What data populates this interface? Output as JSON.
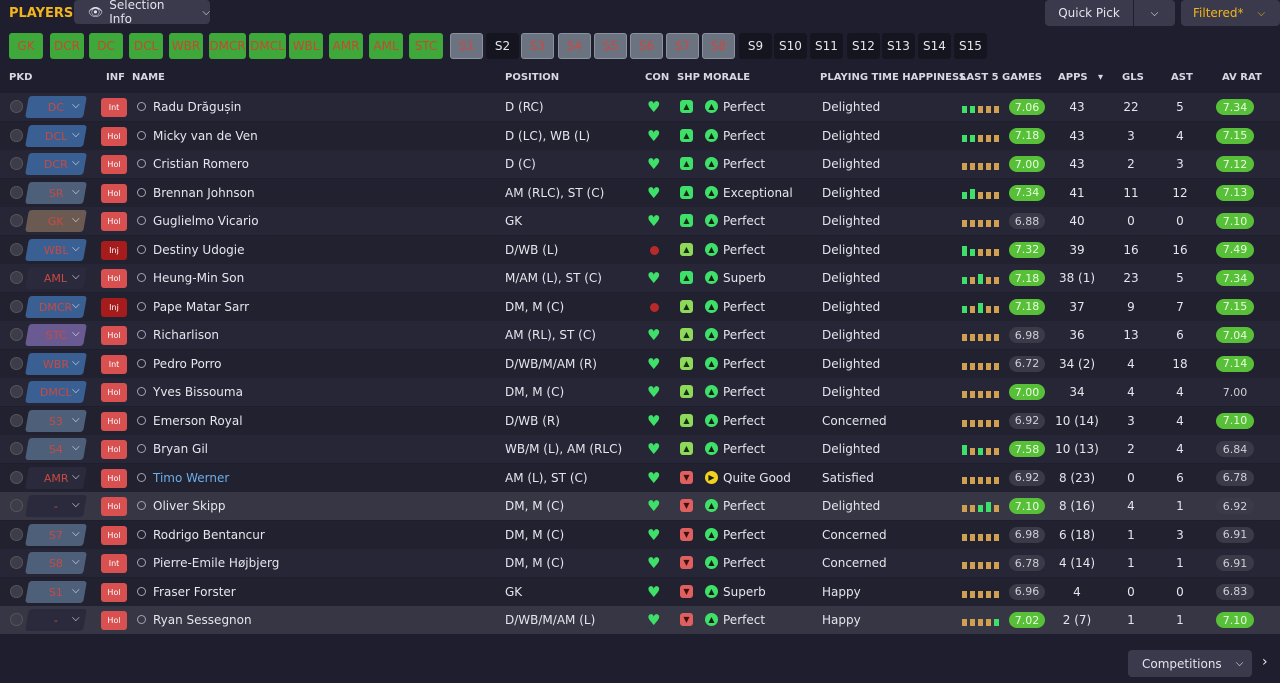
{
  "title": "PLAYERS",
  "selection_info": "Selection Info",
  "quick_pick": "Quick Pick",
  "filtered": "Filtered*",
  "competitions": "Competitions",
  "slots": [
    {
      "label": "GK",
      "style": "g"
    },
    {
      "label": "DCR",
      "style": "g"
    },
    {
      "label": "DC",
      "style": "g"
    },
    {
      "label": "DCL",
      "style": "g"
    },
    {
      "label": "WBR",
      "style": "g"
    },
    {
      "label": "DMCR",
      "style": "g"
    },
    {
      "label": "DMCL",
      "style": "g"
    },
    {
      "label": "WBL",
      "style": "g"
    },
    {
      "label": "AMR",
      "style": "g"
    },
    {
      "label": "AML",
      "style": "g"
    },
    {
      "label": "STC",
      "style": "g"
    },
    {
      "label": "S1",
      "style": "b"
    },
    {
      "label": "S2",
      "style": "k"
    },
    {
      "label": "S3",
      "style": "b"
    },
    {
      "label": "S4",
      "style": "b"
    },
    {
      "label": "S5",
      "style": "b"
    },
    {
      "label": "S6",
      "style": "b"
    },
    {
      "label": "S7",
      "style": "b"
    },
    {
      "label": "S8",
      "style": "b"
    },
    {
      "label": "S9",
      "style": "k"
    },
    {
      "label": "S10",
      "style": "k"
    },
    {
      "label": "S11",
      "style": "k"
    },
    {
      "label": "S12",
      "style": "k"
    },
    {
      "label": "S13",
      "style": "k"
    },
    {
      "label": "S14",
      "style": "k"
    },
    {
      "label": "S15",
      "style": "k"
    }
  ],
  "columns": {
    "pkd": "PKD",
    "inf": "INF",
    "name": "NAME",
    "position": "POSITION",
    "con": "CON",
    "shp": "SHP",
    "morale": "MORALE",
    "pth": "PLAYING TIME HAPPINESS",
    "last5": "LAST 5 GAMES",
    "apps": "APPS",
    "gls": "GLS",
    "ast": "AST",
    "avrat": "AV RAT"
  },
  "colors": {
    "accent": "#f2b51e",
    "green": "#3ee06a",
    "red": "#d85050"
  },
  "players": [
    {
      "pos": "DC",
      "pc": "#3a5f92",
      "inf": "Int",
      "infc": "int",
      "name": "Radu Drăgușin",
      "position": "D (RC)",
      "con": "heart",
      "shp": "up",
      "mor": "g",
      "morale": "Perfect",
      "pth": "Delighted",
      "bars": [
        "g",
        "g",
        "o",
        "o",
        "o"
      ],
      "rating": "7.06",
      "rs": "grn",
      "apps": "43",
      "gls": "22",
      "ast": "5",
      "avrat": "7.34",
      "as": "grn"
    },
    {
      "pos": "DCL",
      "pc": "#3a5f92",
      "inf": "Hol",
      "infc": "hol",
      "name": "Micky van de Ven",
      "position": "D (LC), WB (L)",
      "con": "heart",
      "shp": "up",
      "mor": "g",
      "morale": "Perfect",
      "pth": "Delighted",
      "bars": [
        "g",
        "g",
        "o",
        "o",
        "o"
      ],
      "rating": "7.18",
      "rs": "grn",
      "apps": "43",
      "gls": "3",
      "ast": "4",
      "avrat": "7.15",
      "as": "grn"
    },
    {
      "pos": "DCR",
      "pc": "#3a5f92",
      "inf": "Hol",
      "infc": "hol",
      "name": "Cristian Romero",
      "position": "D (C)",
      "con": "heart",
      "shp": "up",
      "mor": "g",
      "morale": "Perfect",
      "pth": "Delighted",
      "bars": [
        "o",
        "o",
        "o",
        "o",
        "o"
      ],
      "rating": "7.00",
      "rs": "grn",
      "apps": "43",
      "gls": "2",
      "ast": "3",
      "avrat": "7.12",
      "as": "grn"
    },
    {
      "pos": "SR",
      "pc": "#4e5f7a",
      "inf": "Hol",
      "infc": "hol",
      "name": "Brennan Johnson",
      "position": "AM (RLC), ST (C)",
      "con": "heart",
      "shp": "up",
      "mor": "g",
      "morale": "Exceptional",
      "pth": "Delighted",
      "bars": [
        "g",
        "G",
        "o",
        "o",
        "o"
      ],
      "rating": "7.34",
      "rs": "grn",
      "apps": "41",
      "gls": "11",
      "ast": "12",
      "avrat": "7.13",
      "as": "grn"
    },
    {
      "pos": "GK",
      "pc": "#6b5a52",
      "inf": "Hol",
      "infc": "hol",
      "name": "Guglielmo Vicario",
      "position": "GK",
      "con": "heart",
      "shp": "up",
      "mor": "g",
      "morale": "Perfect",
      "pth": "Delighted",
      "bars": [
        "o",
        "o",
        "o",
        "o",
        "o"
      ],
      "rating": "6.88",
      "rs": "gry",
      "apps": "40",
      "gls": "0",
      "ast": "0",
      "avrat": "7.10",
      "as": "grn"
    },
    {
      "pos": "WBL",
      "pc": "#3a5f92",
      "inf": "Inj",
      "infc": "inj",
      "name": "Destiny Udogie",
      "position": "D/WB (L)",
      "con": "inj",
      "shp": "mid",
      "mor": "g",
      "morale": "Perfect",
      "pth": "Delighted",
      "bars": [
        "G",
        "g",
        "o",
        "o",
        "o"
      ],
      "rating": "7.32",
      "rs": "grn",
      "apps": "39",
      "gls": "16",
      "ast": "16",
      "avrat": "7.49",
      "as": "grn"
    },
    {
      "pos": "AML",
      "pc": "#2b2a3c",
      "inf": "Hol",
      "infc": "hol",
      "name": "Heung-Min Son",
      "position": "M/AM (L), ST (C)",
      "con": "heart",
      "shp": "up",
      "mor": "g",
      "morale": "Superb",
      "pth": "Delighted",
      "bars": [
        "g",
        "o",
        "G",
        "o",
        "o"
      ],
      "rating": "7.18",
      "rs": "grn",
      "apps": "38 (1)",
      "gls": "23",
      "ast": "5",
      "avrat": "7.34",
      "as": "grn"
    },
    {
      "pos": "DMCR",
      "pc": "#3a5f92",
      "inf": "Inj",
      "infc": "inj",
      "name": "Pape Matar Sarr",
      "position": "DM, M (C)",
      "con": "inj",
      "shp": "mid",
      "mor": "g",
      "morale": "Perfect",
      "pth": "Delighted",
      "bars": [
        "g",
        "o",
        "G",
        "o",
        "o"
      ],
      "rating": "7.18",
      "rs": "grn",
      "apps": "37",
      "gls": "9",
      "ast": "7",
      "avrat": "7.15",
      "as": "grn"
    },
    {
      "pos": "STC",
      "pc": "#6a5a92",
      "inf": "Hol",
      "infc": "hol",
      "name": "Richarlison",
      "position": "AM (RL), ST (C)",
      "con": "heart",
      "shp": "mid",
      "mor": "g",
      "morale": "Perfect",
      "pth": "Delighted",
      "bars": [
        "o",
        "o",
        "o",
        "o",
        "o"
      ],
      "rating": "6.98",
      "rs": "gry",
      "apps": "36",
      "gls": "13",
      "ast": "6",
      "avrat": "7.04",
      "as": "grn"
    },
    {
      "pos": "WBR",
      "pc": "#3a5f92",
      "inf": "Int",
      "infc": "int",
      "name": "Pedro Porro",
      "position": "D/WB/M/AM (R)",
      "con": "heart",
      "shp": "mid",
      "mor": "g",
      "morale": "Perfect",
      "pth": "Delighted",
      "bars": [
        "o",
        "o",
        "o",
        "o",
        "o"
      ],
      "rating": "6.72",
      "rs": "gry",
      "apps": "34 (2)",
      "gls": "4",
      "ast": "18",
      "avrat": "7.14",
      "as": "grn"
    },
    {
      "pos": "DMCL",
      "pc": "#3a5f92",
      "inf": "Hol",
      "infc": "hol",
      "name": "Yves Bissouma",
      "position": "DM, M (C)",
      "con": "heart",
      "shp": "mid",
      "mor": "g",
      "morale": "Perfect",
      "pth": "Delighted",
      "bars": [
        "o",
        "o",
        "o",
        "o",
        "o"
      ],
      "rating": "7.00",
      "rs": "grn",
      "apps": "34",
      "gls": "4",
      "ast": "4",
      "avrat": "7.00",
      "as": "none"
    },
    {
      "pos": "S3",
      "pc": "#4e5f7a",
      "inf": "Hol",
      "infc": "hol",
      "name": "Emerson Royal",
      "position": "D/WB (R)",
      "con": "heart",
      "shp": "mid",
      "mor": "g",
      "morale": "Perfect",
      "pth": "Concerned",
      "bars": [
        "o",
        "o",
        "o",
        "o",
        "o"
      ],
      "rating": "6.92",
      "rs": "gry",
      "apps": "10 (14)",
      "gls": "3",
      "ast": "4",
      "avrat": "7.10",
      "as": "grn"
    },
    {
      "pos": "S4",
      "pc": "#4e5f7a",
      "inf": "Hol",
      "infc": "hol",
      "name": "Bryan Gil",
      "position": "WB/M (L), AM (RLC)",
      "con": "heart",
      "shp": "mid",
      "mor": "g",
      "morale": "Perfect",
      "pth": "Delighted",
      "bars": [
        "G",
        "o",
        "g",
        "o",
        "o"
      ],
      "rating": "7.58",
      "rs": "grn",
      "apps": "10 (13)",
      "gls": "2",
      "ast": "4",
      "avrat": "6.84",
      "as": "gry"
    },
    {
      "pos": "AMR",
      "pc": "#2b2a3c",
      "inf": "Hol",
      "infc": "hol",
      "name": "Timo Werner",
      "position": "AM (L), ST (C)",
      "con": "heart",
      "shp": "down",
      "mor": "y",
      "morale": "Quite Good",
      "pth": "Satisfied",
      "bars": [
        "o",
        "o",
        "o",
        "o",
        "o"
      ],
      "rating": "6.92",
      "rs": "gry",
      "apps": "8 (23)",
      "gls": "0",
      "ast": "6",
      "avrat": "6.78",
      "as": "gry",
      "blue": true
    },
    {
      "pos": "-",
      "pc": "#2b2a3c",
      "inf": "Hol",
      "infc": "hol",
      "name": "Oliver Skipp",
      "position": "DM, M (C)",
      "con": "heart",
      "shp": "down",
      "mor": "g",
      "morale": "Perfect",
      "pth": "Delighted",
      "bars": [
        "o",
        "o",
        "g",
        "G",
        "o"
      ],
      "rating": "7.10",
      "rs": "grn",
      "apps": "8 (16)",
      "gls": "4",
      "ast": "1",
      "avrat": "6.92",
      "as": "gry"
    },
    {
      "pos": "S7",
      "pc": "#4e5f7a",
      "inf": "Hol",
      "infc": "hol",
      "name": "Rodrigo Bentancur",
      "position": "DM, M (C)",
      "con": "heart",
      "shp": "down",
      "mor": "g",
      "morale": "Perfect",
      "pth": "Concerned",
      "bars": [
        "o",
        "o",
        "o",
        "o",
        "o"
      ],
      "rating": "6.98",
      "rs": "gry",
      "apps": "6 (18)",
      "gls": "1",
      "ast": "3",
      "avrat": "6.91",
      "as": "gry"
    },
    {
      "pos": "S8",
      "pc": "#4e5f7a",
      "inf": "Int",
      "infc": "int",
      "name": "Pierre-Emile Højbjerg",
      "position": "DM, M (C)",
      "con": "heart",
      "shp": "down",
      "mor": "g",
      "morale": "Perfect",
      "pth": "Concerned",
      "bars": [
        "o",
        "o",
        "o",
        "o",
        "o"
      ],
      "rating": "6.78",
      "rs": "gry",
      "apps": "4 (14)",
      "gls": "1",
      "ast": "1",
      "avrat": "6.91",
      "as": "gry"
    },
    {
      "pos": "S1",
      "pc": "#4e5f7a",
      "inf": "Hol",
      "infc": "hol",
      "name": "Fraser Forster",
      "position": "GK",
      "con": "heart",
      "shp": "down",
      "mor": "g",
      "morale": "Superb",
      "pth": "Happy",
      "bars": [
        "o",
        "o",
        "o",
        "o",
        "o"
      ],
      "rating": "6.96",
      "rs": "gry",
      "apps": "4",
      "gls": "0",
      "ast": "0",
      "avrat": "6.83",
      "as": "gry"
    },
    {
      "pos": "-",
      "pc": "#2b2a3c",
      "inf": "Hol",
      "infc": "hol",
      "name": "Ryan Sessegnon",
      "position": "D/WB/M/AM (L)",
      "con": "heart",
      "shp": "down",
      "mor": "g",
      "morale": "Perfect",
      "pth": "Happy",
      "bars": [
        "o",
        "o",
        "o",
        "o",
        "g"
      ],
      "rating": "7.02",
      "rs": "grn",
      "apps": "2 (7)",
      "gls": "1",
      "ast": "1",
      "avrat": "7.10",
      "as": "grn"
    }
  ]
}
